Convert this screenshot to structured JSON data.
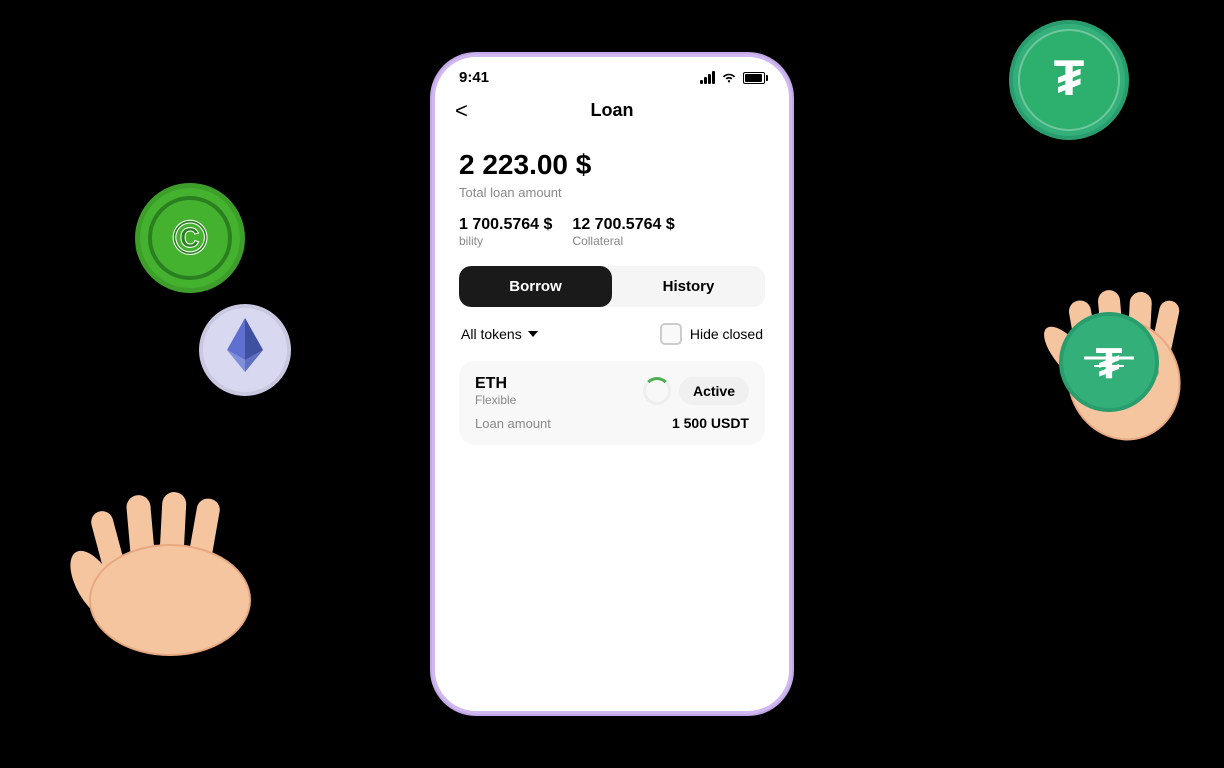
{
  "status_bar": {
    "time": "9:41"
  },
  "header": {
    "title": "Loan",
    "back_label": "<"
  },
  "loan": {
    "total_amount": "2 223.00 $",
    "total_amount_label": "Total loan amount",
    "borrowability_value": "1 700.5764 $",
    "borrowability_label": "bility",
    "collateral_value": "12 700.5764 $",
    "collateral_label": "Collateral"
  },
  "tabs": {
    "borrow_label": "Borrow",
    "history_label": "History"
  },
  "filters": {
    "token_filter_label": "All tokens",
    "hide_closed_label": "Hide closed"
  },
  "loan_card": {
    "token_name": "ETH",
    "token_type": "Flexible",
    "status_label": "Active",
    "detail_label": "Loan amount",
    "detail_value": "1 500 USDT"
  }
}
